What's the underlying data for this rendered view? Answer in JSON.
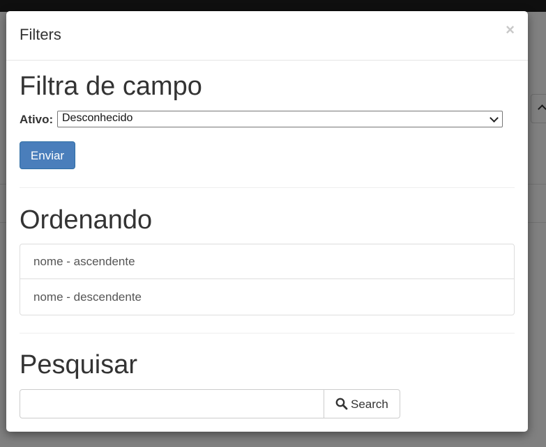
{
  "modal": {
    "title": "Filters",
    "close_symbol": "×"
  },
  "field_filter": {
    "heading": "Filtra de campo",
    "ativo_label": "Ativo:",
    "ativo_selected": "Desconhecido",
    "submit_label": "Enviar"
  },
  "ordering": {
    "heading": "Ordenando",
    "items": [
      {
        "label": "nome - ascendente"
      },
      {
        "label": "nome - descendente"
      }
    ]
  },
  "search": {
    "heading": "Pesquisar",
    "input_value": "",
    "button_label": "Search",
    "button_icon": "search-icon"
  },
  "colors": {
    "primary": "#4a7ebb",
    "overlay": "#808080",
    "topbar": "#0f0f0f"
  }
}
